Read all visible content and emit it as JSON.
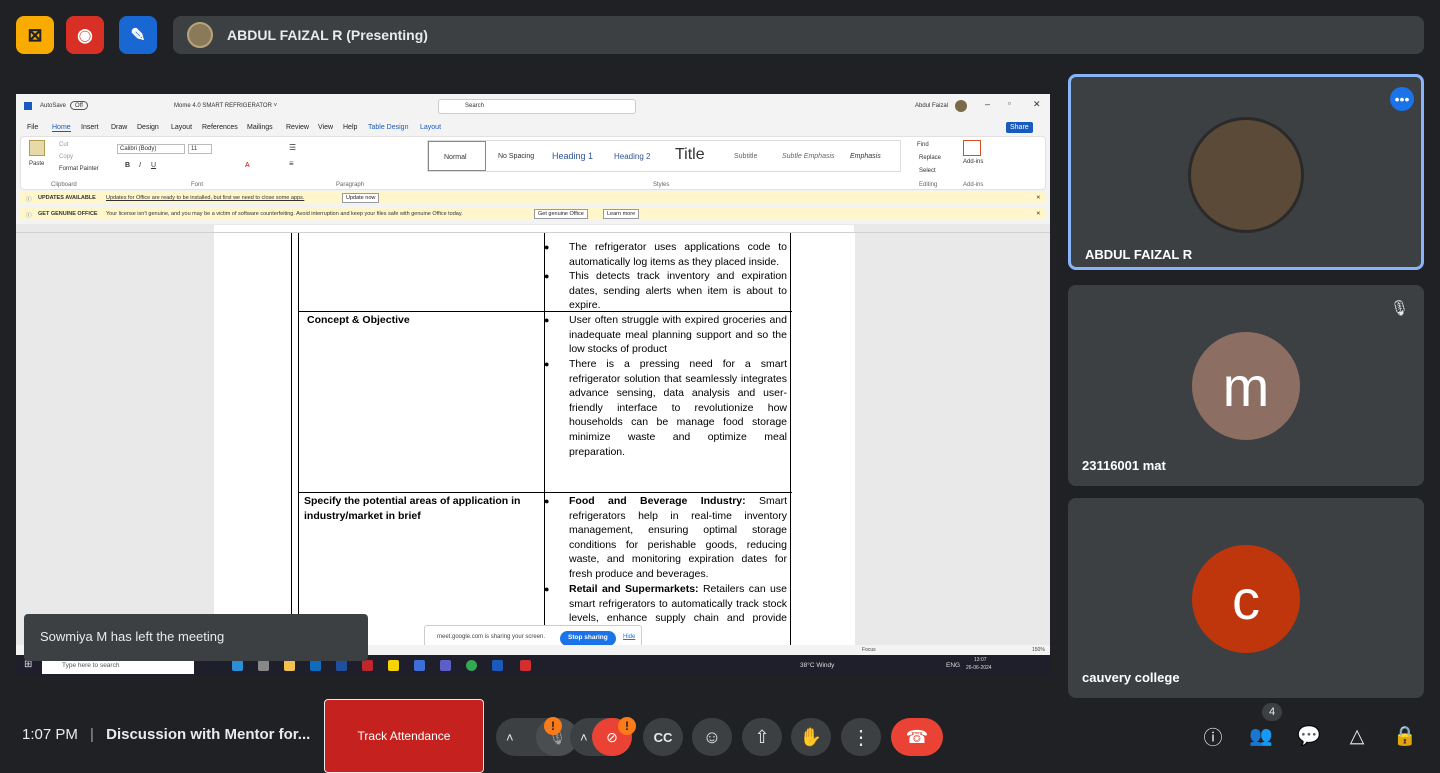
{
  "top": {
    "presenter_name": "ABDUL FAIZAL R (Presenting)"
  },
  "shared_window": {
    "title": {
      "autosave_label": "AutoSave",
      "autosave_state": "Off",
      "doc_title": "Mome 4.0 SMART REFRIGERATOR ˅",
      "search_placeholder": "Search",
      "user": "Abdul Faizal"
    },
    "tabs": [
      "File",
      "Home",
      "Insert",
      "Draw",
      "Design",
      "Layout",
      "References",
      "Mailings",
      "Review",
      "View",
      "Help",
      "Table Design",
      "Layout"
    ],
    "share_label": "Share",
    "ribbon": {
      "paste": "Paste",
      "cut": "Cut",
      "copy": "Copy",
      "format_painter": "Format Painter",
      "clipboard": "Clipboard",
      "font_name": "Calibri (Body)",
      "font_size": "11",
      "font_group": "Font",
      "paragraph_group": "Paragraph",
      "styles": [
        "Normal",
        "No Spacing",
        "Heading 1",
        "Heading 2",
        "Title",
        "Subtitle",
        "Subtle Emphasis",
        "Emphasis"
      ],
      "styles_group": "Styles",
      "find": "Find",
      "replace": "Replace",
      "select": "Select",
      "editing_group": "Editing",
      "addins": "Add-ins",
      "addins_group": "Add-ins"
    },
    "notices": [
      {
        "label": "UPDATES AVAILABLE",
        "text": "Updates for Office are ready to be installed, but first we need to close some apps.",
        "buttons": [
          "Update now"
        ]
      },
      {
        "label": "GET GENUINE OFFICE",
        "text": "Your license isn't genuine, and you may be a victim of software counterfeiting. Avoid interruption and keep your files safe with genuine Office today.",
        "buttons": [
          "Get genuine Office",
          "Learn more"
        ]
      }
    ],
    "document": {
      "row1_bullets": [
        "The refrigerator uses applications code to automatically log items as they placed inside.",
        "This detects track inventory and expiration dates, sending alerts when item is about to expire."
      ],
      "row2_heading": "Concept & Objective",
      "row2_bullets": [
        "User often struggle with expired groceries and inadequate meal planning support and so the low stocks of product",
        "There is a pressing need for a smart refrigerator solution that seamlessly integrates advance sensing, data analysis and user-friendly interface to revolutionize how households can be manage food storage minimize waste and optimize meal preparation."
      ],
      "row3_heading": "Specify the potential areas of application in industry/market in brief",
      "row3_b1_bold": "Food and Beverage Industry:",
      "row3_b1_text": " Smart refrigerators help in real-time inventory management, ensuring optimal storage conditions for perishable goods, reducing waste, and monitoring expiration dates for fresh produce and beverages.",
      "row3_b2_bold": "Retail and Supermarkets:",
      "row3_b2_text": " Retailers can use smart refrigerators to automatically track stock levels, enhance supply chain and provide notifications for"
    },
    "share_popup": {
      "text": "meet.google.com is sharing your screen.",
      "stop": "Stop sharing",
      "hide": "Hide"
    },
    "status": {
      "focus": "Focus",
      "zoom": "150%"
    },
    "taskbar": {
      "search_placeholder": "Type here to search",
      "weather": "38°C  Windy",
      "lang": "ENG",
      "time": "13:07",
      "date": "26-06-2024"
    }
  },
  "toast": "Sowmiya M has left the meeting",
  "tiles": [
    {
      "name": "ABDUL FAIZAL R",
      "active": true
    },
    {
      "name": "23116001 mat",
      "initial": "m",
      "avatar_color": "#8d6e63",
      "muted": true
    },
    {
      "name": "cauvery college",
      "initial": "c",
      "avatar_color": "#bf360c"
    }
  ],
  "bottom": {
    "time": "1:07 PM",
    "separator": "|",
    "meeting_title": "Discussion with Mentor for...",
    "track_attendance": "Track Attendance",
    "participants_count": "4",
    "mic_badge": "!",
    "cam_badge": "!"
  },
  "colors": {
    "accent_blue": "#8ab4f8",
    "end_call_red": "#ea4335",
    "track_red": "#c5221f"
  }
}
